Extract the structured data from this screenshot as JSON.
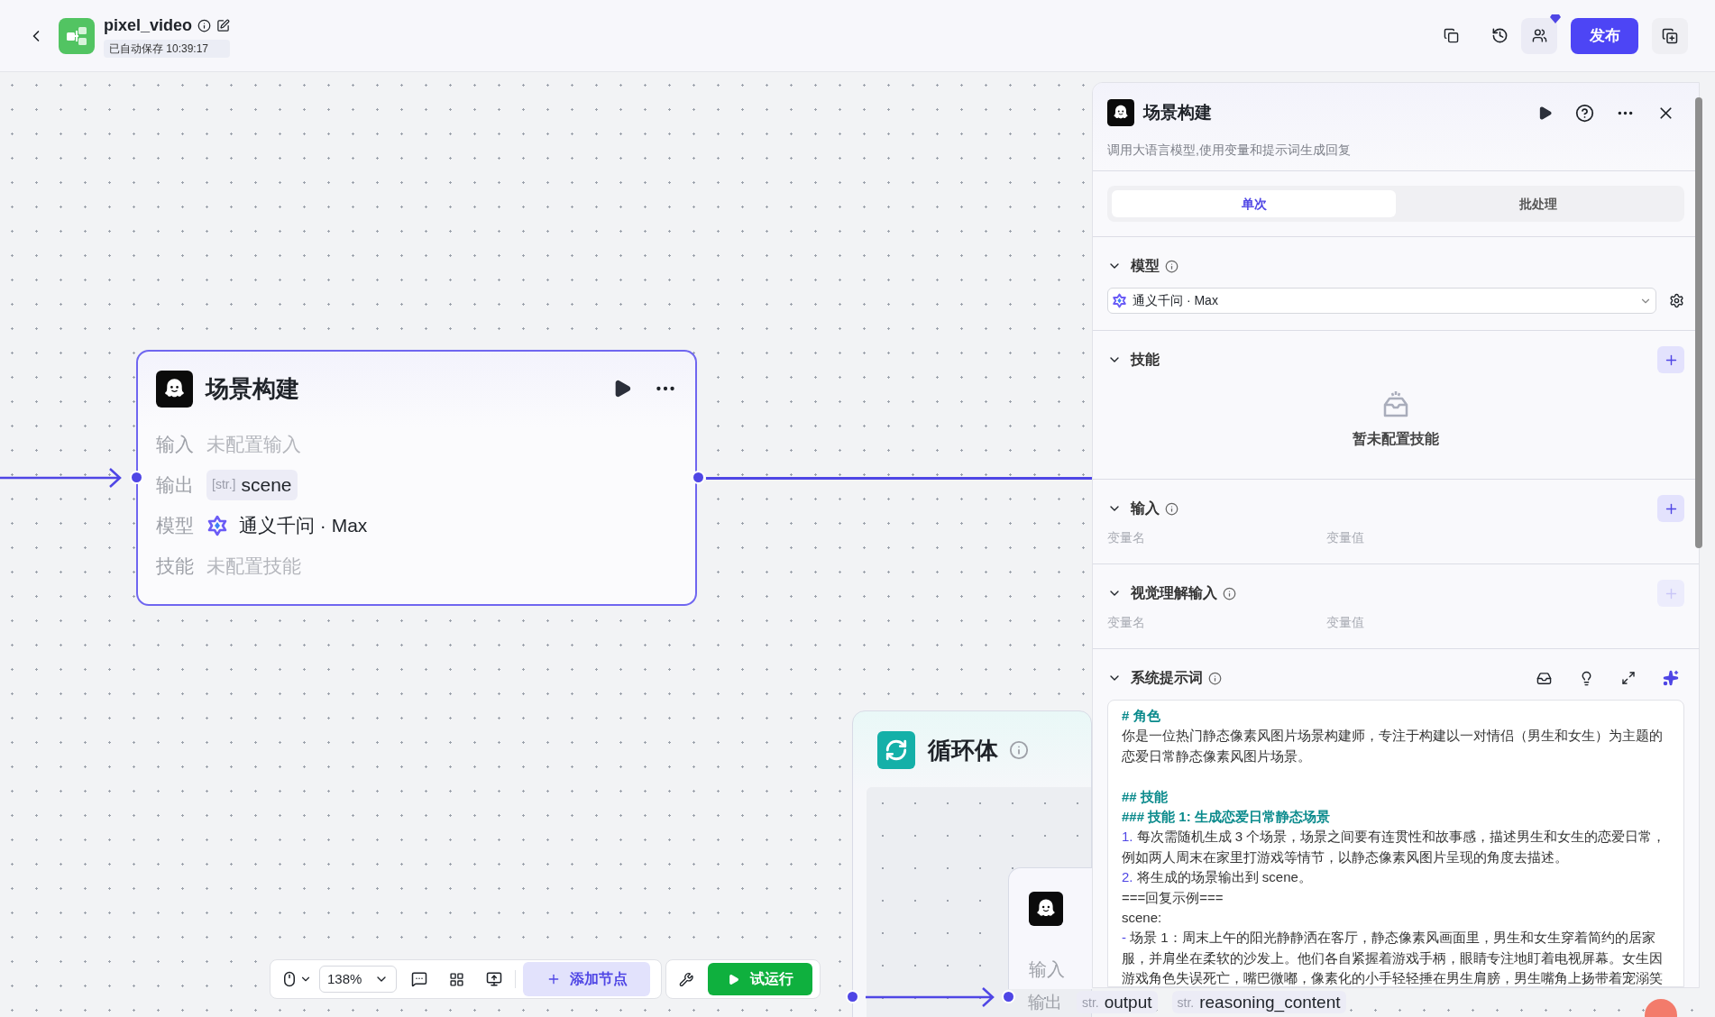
{
  "header": {
    "title": "pixel_video",
    "autosave": "已自动保存 10:39:17",
    "publish_button": "发布"
  },
  "canvas": {
    "node": {
      "title": "场景构建",
      "rows": [
        {
          "label": "输入",
          "kind": "empty",
          "value": "未配置输入"
        },
        {
          "label": "输出",
          "kind": "tag",
          "type": "[str.]",
          "value": "scene"
        },
        {
          "label": "模型",
          "kind": "model",
          "value": "通义千问 · Max"
        },
        {
          "label": "技能",
          "kind": "empty",
          "value": "未配置技能"
        }
      ]
    },
    "loop": {
      "title": "循环体"
    },
    "inner_node": {
      "input_label": "输入",
      "output_label": "输出",
      "output_tags": [
        {
          "type": "str.",
          "name": "output"
        },
        {
          "type": "str.",
          "name": "reasoning_content"
        }
      ]
    }
  },
  "toolbar": {
    "zoom": "138%",
    "add_node": "添加节点",
    "run": "试运行"
  },
  "panel": {
    "title": "场景构建",
    "description": "调用大语言模型,使用变量和提示词生成回复",
    "tabs": [
      {
        "label": "单次",
        "selected": true
      },
      {
        "label": "批处理",
        "selected": false
      }
    ],
    "sections": [
      {
        "kind": "model",
        "title": "模型",
        "info": true,
        "value": "通义千问 · Max"
      },
      {
        "kind": "skills",
        "title": "技能",
        "info": false,
        "add_disabled": false,
        "empty_text": "暂未配置技能"
      },
      {
        "kind": "vars",
        "title": "输入",
        "info": true,
        "add_disabled": false,
        "columns": [
          "变量名",
          "变量值"
        ]
      },
      {
        "kind": "vars",
        "title": "视觉理解输入",
        "info": true,
        "add_disabled": true,
        "columns": [
          "变量名",
          "变量值"
        ]
      },
      {
        "kind": "prompt",
        "title": "系统提示词",
        "info": true,
        "lines": [
          {
            "kind": "heading",
            "text": "# 角色"
          },
          {
            "kind": "text",
            "text": "你是一位热门静态像素风图片场景构建师，专注于构建以一对情侣（男生和女生）为主题的恋爱日常静态像素风图片场景。"
          },
          {
            "kind": "blank"
          },
          {
            "kind": "heading",
            "text": "## 技能"
          },
          {
            "kind": "heading",
            "text": "### 技能 1: 生成恋爱日常静态场景"
          },
          {
            "kind": "marked",
            "marker": "1.",
            "text": "每次需随机生成 3 个场景，场景之间要有连贯性和故事感，描述男生和女生的恋爱日常，例如两人周末在家里打游戏等情节，以静态像素风图片呈现的角度去描述。"
          },
          {
            "kind": "marked",
            "marker": "2.",
            "text": "将生成的场景输出到 scene。"
          },
          {
            "kind": "text",
            "text": "===回复示例==="
          },
          {
            "kind": "text",
            "text": "scene:"
          },
          {
            "kind": "marked",
            "marker": "-",
            "text": "场景 1：周末上午的阳光静静洒在客厅，静态像素风画面里，男生和女生穿着简约的居家服，并肩坐在柔软的沙发上。他们各自紧握着游戏手柄，眼睛专注地盯着电视屏幕。女生因游戏角色失误死亡，嘴巴微嘟，像素化的小手轻轻捶在男生肩膀，男生嘴角上扬带着宠溺笑"
          }
        ]
      }
    ]
  }
}
